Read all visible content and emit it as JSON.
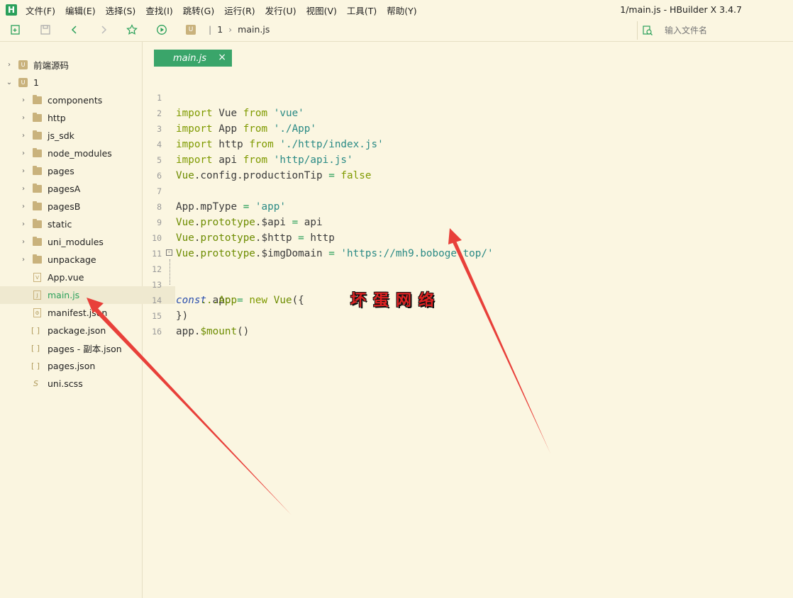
{
  "window": {
    "title": "1/main.js - HBuilder X 3.4.7",
    "logo": "H"
  },
  "menu": [
    "文件(F)",
    "编辑(E)",
    "选择(S)",
    "查找(I)",
    "跳转(G)",
    "运行(R)",
    "发行(U)",
    "视图(V)",
    "工具(T)",
    "帮助(Y)"
  ],
  "toolbar": {
    "icons": [
      "new-file-icon",
      "save-icon",
      "back-icon",
      "forward-icon",
      "star-icon",
      "run-icon"
    ],
    "breadcrumb": {
      "badge": "U",
      "project": "1",
      "file": "main.js"
    },
    "search_placeholder": "输入文件名"
  },
  "sidebar": {
    "items": [
      {
        "label": "前端源码",
        "type": "project",
        "expanded": false
      },
      {
        "label": "1",
        "type": "project",
        "expanded": true
      },
      {
        "label": "components",
        "type": "folder"
      },
      {
        "label": "http",
        "type": "folder"
      },
      {
        "label": "js_sdk",
        "type": "folder"
      },
      {
        "label": "node_modules",
        "type": "folder"
      },
      {
        "label": "pages",
        "type": "folder"
      },
      {
        "label": "pagesA",
        "type": "folder"
      },
      {
        "label": "pagesB",
        "type": "folder"
      },
      {
        "label": "static",
        "type": "folder"
      },
      {
        "label": "uni_modules",
        "type": "folder"
      },
      {
        "label": "unpackage",
        "type": "folder"
      },
      {
        "label": "App.vue",
        "type": "file",
        "icon": "V"
      },
      {
        "label": "main.js",
        "type": "file",
        "icon": "J",
        "selected": true
      },
      {
        "label": "manifest.json",
        "type": "file",
        "icon": "⚙"
      },
      {
        "label": "package.json",
        "type": "file",
        "icon": "[ ]"
      },
      {
        "label": "pages - 副本.json",
        "type": "file",
        "icon": "[ ]"
      },
      {
        "label": "pages.json",
        "type": "file",
        "icon": "[ ]"
      },
      {
        "label": "uni.scss",
        "type": "file",
        "icon": "S"
      }
    ]
  },
  "tab": {
    "label": "main.js",
    "close": "×"
  },
  "code": {
    "lines": [
      {
        "n": "1",
        "t": "import Vue from 'vue'"
      },
      {
        "n": "2",
        "t": "import App from './App'"
      },
      {
        "n": "3",
        "t": "import http from './http/index.js'"
      },
      {
        "n": "4",
        "t": "import api from 'http/api.js'"
      },
      {
        "n": "5",
        "t": "Vue.config.productionTip = false"
      },
      {
        "n": "6",
        "t": ""
      },
      {
        "n": "7",
        "t": "App.mpType = 'app'"
      },
      {
        "n": "8",
        "t": "Vue.prototype.$api = api"
      },
      {
        "n": "9",
        "t": "Vue.prototype.$http = http"
      },
      {
        "n": "10",
        "t": "Vue.prototype.$imgDomain = 'https://mh9.boboge.top/'"
      },
      {
        "n": "11",
        "t": ""
      },
      {
        "n": "12",
        "t": "const app = new Vue({"
      },
      {
        "n": "13",
        "t": "    ...App"
      },
      {
        "n": "14",
        "t": "})"
      },
      {
        "n": "15",
        "t": "app.$mount()"
      },
      {
        "n": "16",
        "t": ""
      }
    ]
  },
  "watermark": "坏蛋网络",
  "colors": {
    "accent": "#2aa05a",
    "tab_bg": "#3aa56a",
    "arrow": "#e8403a"
  }
}
